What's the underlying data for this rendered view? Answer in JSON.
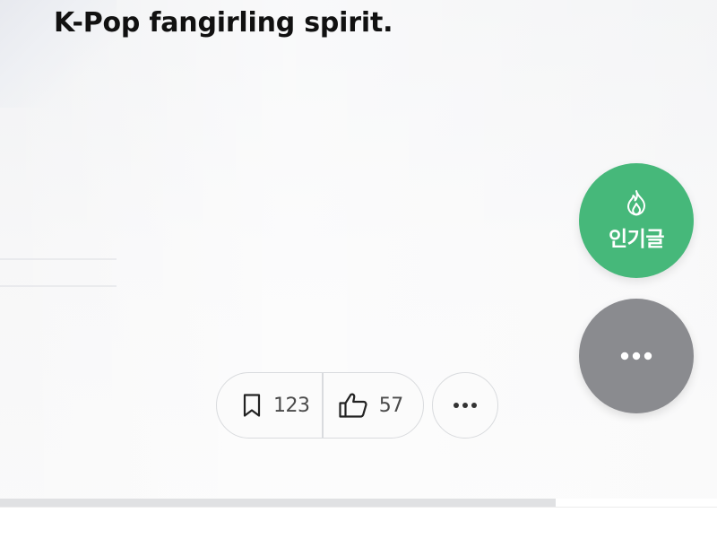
{
  "article": {
    "headline_line_cut": "K-Pop fangirling spirit.",
    "headline": "K-Pop fangirling spirit."
  },
  "reactions": {
    "bookmark_icon": "bookmark-icon",
    "bookmark_count": "123",
    "like_icon": "thumbs-up-icon",
    "like_count": "57",
    "more_icon": "ellipsis-icon"
  },
  "floating": {
    "popular_icon": "fire-icon",
    "popular_label": "인기글",
    "popular_color": "#46b87a",
    "more_icon": "ellipsis-icon",
    "more_color": "#8a8b8f"
  },
  "reading_progress": {
    "fraction": 0.775
  }
}
